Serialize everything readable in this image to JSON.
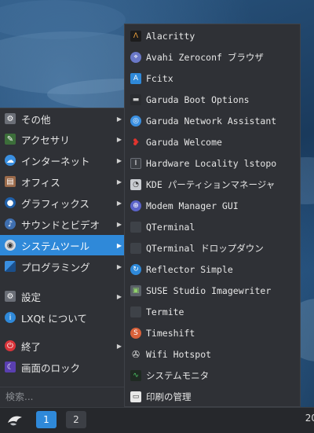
{
  "main_menu": {
    "items": [
      {
        "label": "その他",
        "icon": "other-icon",
        "submenu": true
      },
      {
        "label": "アクセサリ",
        "icon": "accessories-icon",
        "submenu": true
      },
      {
        "label": "インターネット",
        "icon": "internet-icon",
        "submenu": true
      },
      {
        "label": "オフィス",
        "icon": "office-icon",
        "submenu": true
      },
      {
        "label": "グラフィックス",
        "icon": "graphics-icon",
        "submenu": true
      },
      {
        "label": "サウンドとビデオ",
        "icon": "multimedia-icon",
        "submenu": true
      },
      {
        "label": "システムツール",
        "icon": "system-tools-icon",
        "submenu": true,
        "selected": true
      },
      {
        "label": "プログラミング",
        "icon": "programming-icon",
        "submenu": true
      }
    ],
    "settings_label": "設定",
    "about_label": "LXQt について",
    "quit_label": "終了",
    "lock_label": "画面のロック",
    "search_placeholder": "検索..."
  },
  "submenu": {
    "items": [
      {
        "label": "Alacritty",
        "icon": "alacritty-icon"
      },
      {
        "label": "Avahi Zeroconf ブラウザ",
        "icon": "avahi-icon"
      },
      {
        "label": "Fcitx",
        "icon": "fcitx-icon"
      },
      {
        "label": "Garuda Boot Options",
        "icon": "garuda-boot-icon"
      },
      {
        "label": "Garuda Network Assistant",
        "icon": "network-assistant-icon"
      },
      {
        "label": "Garuda Welcome",
        "icon": "garuda-welcome-icon"
      },
      {
        "label": "Hardware Locality lstopo",
        "icon": "lstopo-icon"
      },
      {
        "label": "KDE パーティションマネージャ",
        "icon": "partition-manager-icon"
      },
      {
        "label": "Modem Manager GUI",
        "icon": "modem-manager-icon"
      },
      {
        "label": "QTerminal",
        "icon": "qterminal-icon"
      },
      {
        "label": "QTerminal ドロップダウン",
        "icon": "qterminal-dropdown-icon"
      },
      {
        "label": "Reflector Simple",
        "icon": "reflector-icon"
      },
      {
        "label": "SUSE Studio Imagewriter",
        "icon": "imagewriter-icon"
      },
      {
        "label": "Termite",
        "icon": "termite-icon"
      },
      {
        "label": "Timeshift",
        "icon": "timeshift-icon"
      },
      {
        "label": "Wifi Hotspot",
        "icon": "wifi-hotspot-icon"
      },
      {
        "label": "システムモニタ",
        "icon": "system-monitor-icon"
      },
      {
        "label": "印刷の管理",
        "icon": "print-manager-icon"
      }
    ]
  },
  "taskbar": {
    "desktop_1": "1",
    "desktop_2": "2",
    "clock": "20"
  },
  "colors": {
    "accent": "#2f89d9",
    "menu_bg": "#2f3136",
    "taskbar_bg": "#26282c"
  }
}
